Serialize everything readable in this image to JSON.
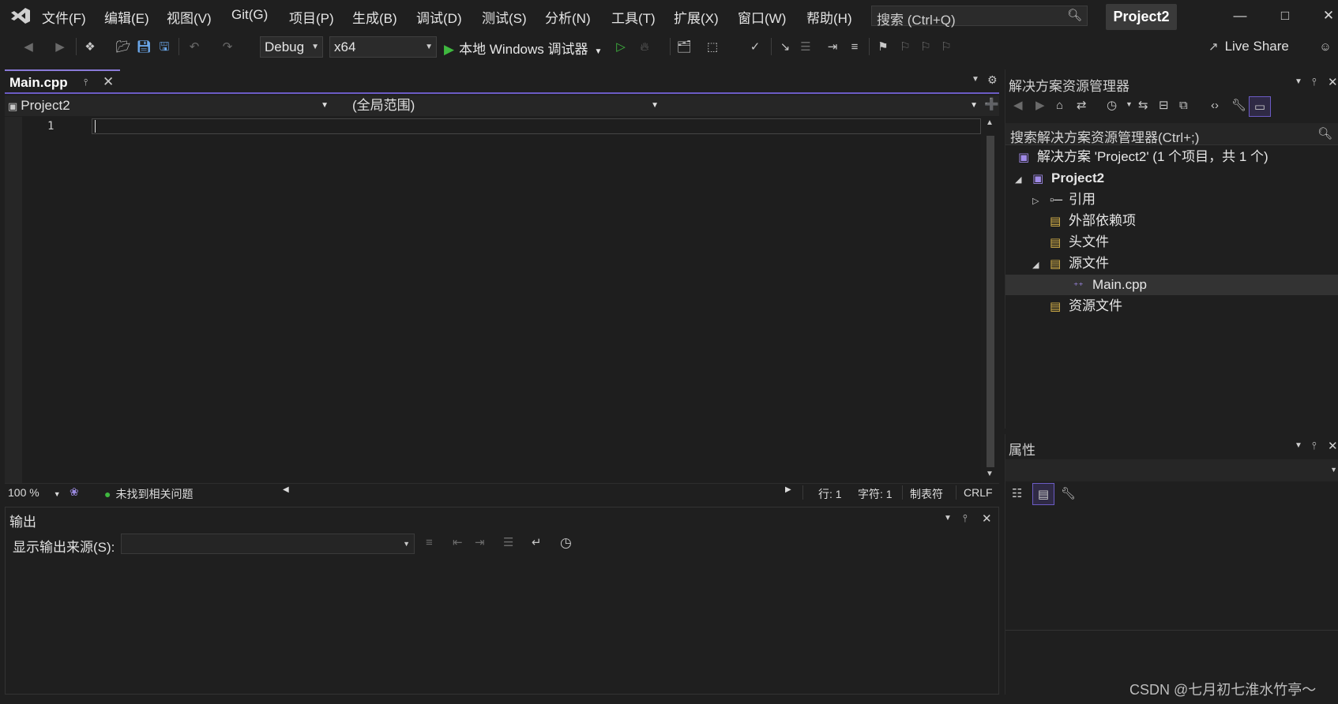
{
  "window": {
    "menu": [
      "文件(F)",
      "编辑(E)",
      "视图(V)",
      "Git(G)",
      "项目(P)",
      "生成(B)",
      "调试(D)",
      "测试(S)",
      "分析(N)",
      "工具(T)",
      "扩展(X)",
      "窗口(W)",
      "帮助(H)"
    ],
    "search_placeholder": "搜索 (Ctrl+Q)",
    "project_badge": "Project2",
    "icons": {
      "logo": "visual-studio-logo-icon",
      "minimize": "minimize-icon",
      "maximize": "maximize-icon",
      "close": "close-icon"
    }
  },
  "toolbar": {
    "configuration": "Debug",
    "platform": "x64",
    "run_label": "本地 Windows 调试器",
    "live_share": "Live Share"
  },
  "editor": {
    "tab_title": "Main.cpp",
    "nav_project": "Project2",
    "nav_scope": "(全局范围)",
    "line_number": "1",
    "zoom": "100 %",
    "issues": "未找到相关问题",
    "line": "行: 1",
    "char": "字符: 1",
    "indent": "制表符",
    "eol": "CRLF"
  },
  "output": {
    "title": "输出",
    "source_label": "显示输出来源(S):",
    "source_value": ""
  },
  "solution_explorer": {
    "title": "解决方案资源管理器",
    "search_placeholder": "搜索解决方案资源管理器(Ctrl+;)",
    "items": [
      {
        "label": "解决方案 'Project2' (1 个项目，共 1 个)",
        "bold": false
      },
      {
        "label": "Project2",
        "bold": true
      },
      {
        "label": "引用",
        "bold": false
      },
      {
        "label": "外部依赖项",
        "bold": false
      },
      {
        "label": "头文件",
        "bold": false
      },
      {
        "label": "源文件",
        "bold": false
      },
      {
        "label": "Main.cpp",
        "bold": false
      },
      {
        "label": "资源文件",
        "bold": false
      }
    ]
  },
  "properties": {
    "title": "属性"
  },
  "watermark": "CSDN @七月初七淮水竹亭～",
  "colors": {
    "accent": "#8a7ad8",
    "run_green": "#3fb83f",
    "ok_green": "#3fb83f"
  }
}
